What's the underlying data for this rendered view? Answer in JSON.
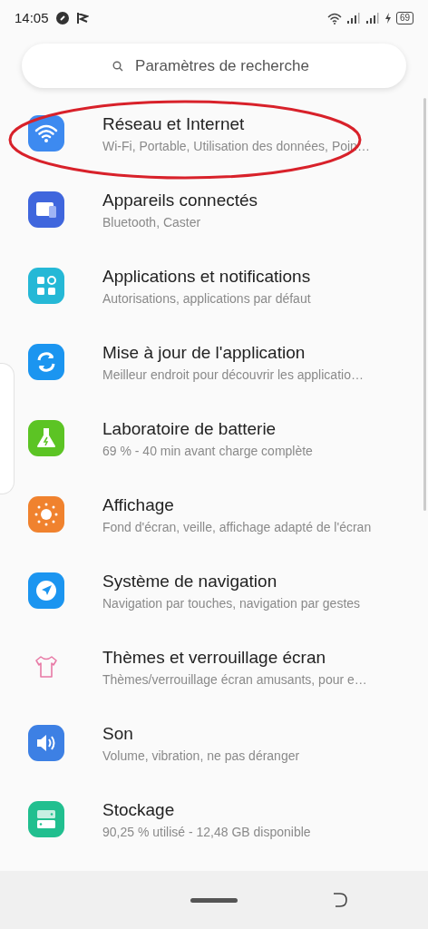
{
  "status_bar": {
    "time": "14:05",
    "battery": "69"
  },
  "search": {
    "placeholder": "Paramètres de recherche"
  },
  "items": [
    {
      "kind": "wifi",
      "title": "Réseau et Internet",
      "subtitle": "Wi-Fi, Portable, Utilisation des données, Poin…",
      "circled": true
    },
    {
      "kind": "devices",
      "title": "Appareils connectés",
      "subtitle": "Bluetooth, Caster",
      "circled": false
    },
    {
      "kind": "apps",
      "title": "Applications et notifications",
      "subtitle": "Autorisations, applications par défaut",
      "circled": false
    },
    {
      "kind": "update",
      "title": "Mise à jour de l'application",
      "subtitle": "Meilleur endroit pour découvrir les applicatio…",
      "circled": false
    },
    {
      "kind": "battery",
      "title": "Laboratoire de batterie",
      "subtitle": "69 % - 40 min avant charge complète",
      "circled": false
    },
    {
      "kind": "display",
      "title": "Affichage",
      "subtitle": "Fond d'écran, veille, affichage adapté de l'écran",
      "circled": false
    },
    {
      "kind": "navigation",
      "title": "Système de navigation",
      "subtitle": "Navigation par touches, navigation par gestes",
      "circled": false
    },
    {
      "kind": "themes",
      "title": "Thèmes et verrouillage écran",
      "subtitle": "Thèmes/verrouillage écran amusants, pour e…",
      "circled": false
    },
    {
      "kind": "sound",
      "title": "Son",
      "subtitle": "Volume, vibration, ne pas déranger",
      "circled": false
    },
    {
      "kind": "storage",
      "title": "Stockage",
      "subtitle": "90,25 % utilisé - 12,48 GB disponible",
      "circled": false
    }
  ]
}
